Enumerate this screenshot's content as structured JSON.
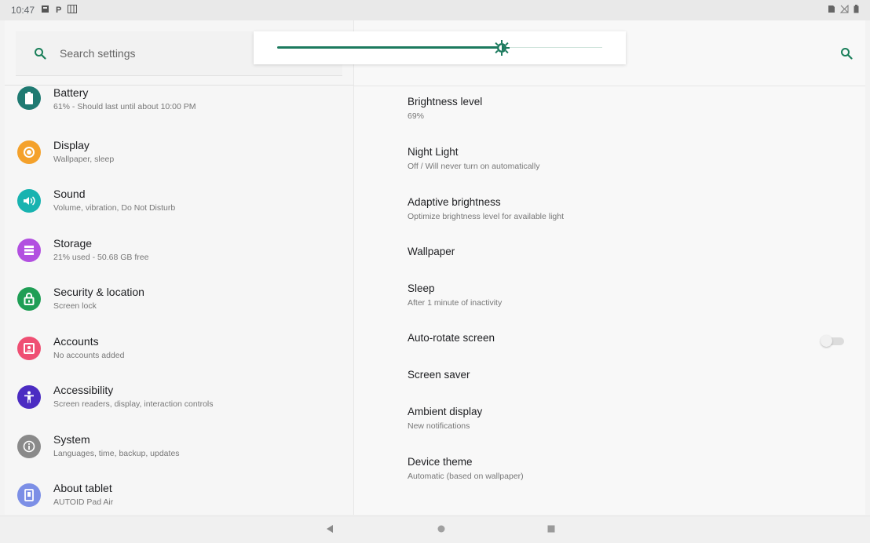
{
  "status_bar": {
    "time": "10:47",
    "left_icons": [
      "notification-icon",
      "p-icon",
      "gallery-icon"
    ],
    "right_icons": [
      "sim-icon",
      "no-signal-icon",
      "battery-icon"
    ]
  },
  "search": {
    "placeholder": "Search settings",
    "icon": "search-icon",
    "accent_color": "#1a7f5a"
  },
  "brightness_popup": {
    "level_fraction": 0.69,
    "accent_color": "#1c7a5e"
  },
  "categories": [
    {
      "title": "Battery",
      "subtitle": "61% - Should last until about 10:00 PM",
      "icon": "battery-icon",
      "color": "#1f7a72"
    },
    {
      "title": "Display",
      "subtitle": "Wallpaper, sleep",
      "icon": "brightness-icon",
      "color": "#f4a12b"
    },
    {
      "title": "Sound",
      "subtitle": "Volume, vibration, Do Not Disturb",
      "icon": "volume-icon",
      "color": "#18b3b0"
    },
    {
      "title": "Storage",
      "subtitle": "21% used - 50.68 GB free",
      "icon": "storage-icon",
      "color": "#b24fe0"
    },
    {
      "title": "Security & location",
      "subtitle": "Screen lock",
      "icon": "lock-icon",
      "color": "#1f9e55"
    },
    {
      "title": "Accounts",
      "subtitle": "No accounts added",
      "icon": "account-icon",
      "color": "#ef4f73"
    },
    {
      "title": "Accessibility",
      "subtitle": "Screen readers, display, interaction controls",
      "icon": "accessibility-icon",
      "color": "#4b2cc2"
    },
    {
      "title": "System",
      "subtitle": "Languages, time, backup, updates",
      "icon": "info-icon",
      "color": "#8a8a8a"
    },
    {
      "title": "About tablet",
      "subtitle": "AUTOID Pad Air",
      "icon": "tablet-icon",
      "color": "#7c8fe6"
    }
  ],
  "display_settings": [
    {
      "title": "Brightness level",
      "subtitle": "69%"
    },
    {
      "title": "Night Light",
      "subtitle": "Off / Will never turn on automatically"
    },
    {
      "title": "Adaptive brightness",
      "subtitle": "Optimize brightness level for available light"
    },
    {
      "title": "Wallpaper",
      "subtitle": ""
    },
    {
      "title": "Sleep",
      "subtitle": "After 1 minute of inactivity"
    },
    {
      "title": "Auto-rotate screen",
      "subtitle": "",
      "toggle": false
    },
    {
      "title": "Screen saver",
      "subtitle": ""
    },
    {
      "title": "Ambient display",
      "subtitle": "New notifications"
    },
    {
      "title": "Device theme",
      "subtitle": "Automatic (based on wallpaper)"
    }
  ],
  "nav_bar": {
    "buttons": [
      "back-icon",
      "home-icon",
      "recents-icon"
    ]
  }
}
